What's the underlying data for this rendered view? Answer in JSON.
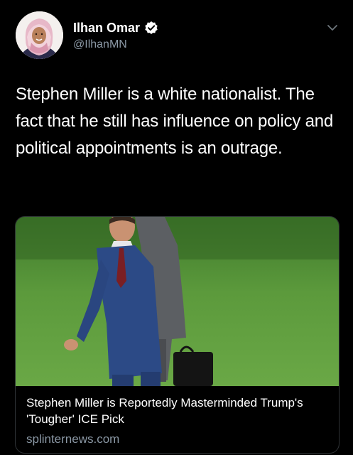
{
  "author": {
    "name": "Ilhan Omar",
    "handle": "@IlhanMN",
    "verified": true,
    "avatar_icon": "profile-avatar"
  },
  "menu": {
    "icon": "chevron-down-icon"
  },
  "tweet": {
    "text": "Stephen Miller is a white nationalist. The fact that he still has influence on policy and political appointments is an outrage."
  },
  "link_card": {
    "title": "Stephen Miller is Reportedly Masterminded Trump's 'Tougher' ICE Pick",
    "domain": "splinternews.com",
    "image_icon": "article-photo"
  },
  "colors": {
    "background": "#000000",
    "text": "#ffffff",
    "secondary_text": "#8b98a5",
    "card_border": "#2f3336",
    "verified_badge": "#ffffff"
  }
}
